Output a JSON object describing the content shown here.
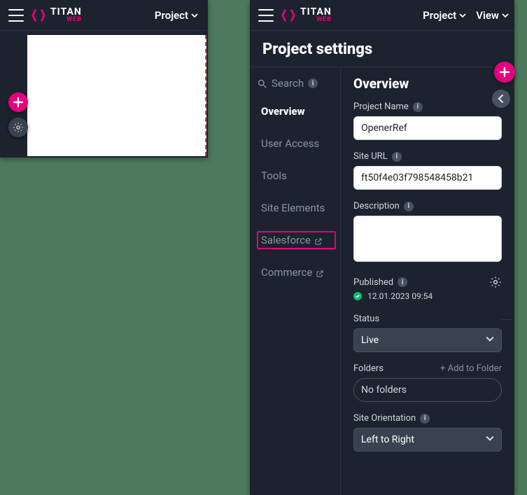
{
  "brand": {
    "name": "TITAN",
    "sub": "WEB"
  },
  "topMenus": {
    "project": "Project",
    "view": "View"
  },
  "pageTitle": "Project settings",
  "search": {
    "placeholder": "Search"
  },
  "nav": {
    "items": [
      {
        "label": "Overview",
        "active": true,
        "external": false,
        "highlight": false
      },
      {
        "label": "User Access",
        "active": false,
        "external": false,
        "highlight": false
      },
      {
        "label": "Tools",
        "active": false,
        "external": false,
        "highlight": false
      },
      {
        "label": "Site Elements",
        "active": false,
        "external": false,
        "highlight": false
      },
      {
        "label": "Salesforce",
        "active": false,
        "external": true,
        "highlight": true
      },
      {
        "label": "Commerce",
        "active": false,
        "external": true,
        "highlight": false
      }
    ]
  },
  "overview": {
    "heading": "Overview",
    "projectName": {
      "label": "Project Name",
      "value": "OpenerRef"
    },
    "siteUrl": {
      "label": "Site URL",
      "value": "ft50f4e03f798548458b21"
    },
    "description": {
      "label": "Description",
      "value": ""
    },
    "published": {
      "label": "Published",
      "timestamp": "12.01.2023 09:54"
    },
    "status": {
      "label": "Status",
      "value": "Live"
    },
    "folders": {
      "label": "Folders",
      "addLabel": "+ Add to Folder",
      "value": "No folders"
    },
    "siteOrientation": {
      "label": "Site Orientation",
      "value": "Left to Right"
    }
  },
  "colors": {
    "accent": "#e6007e",
    "navHighlight": "#e6007e",
    "success": "#11b86f"
  }
}
